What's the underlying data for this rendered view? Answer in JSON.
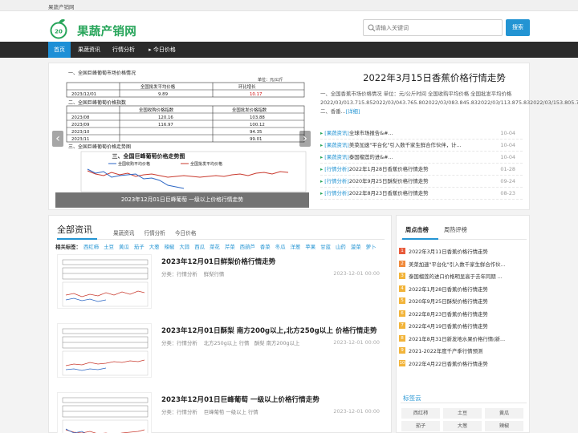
{
  "site": {
    "top_label": "果蔬产销网",
    "logo_text": "果蔬产销网",
    "logo_badge": "20"
  },
  "search": {
    "placeholder": "请输入关键词",
    "button": "搜索"
  },
  "nav": [
    "首页",
    "果蔬资讯",
    "行情分析",
    "▸ 今日价格"
  ],
  "feature": {
    "slide_caption": "2023年12月01日巨峰葡萄 一级以上价格行情走势",
    "chart": {
      "table1_title": "一、全国巨峰葡萄市场价格情况",
      "table1_header": [
        "",
        "全国批发平均价格",
        "环比增长"
      ],
      "table1_rows": [
        [
          "2023/12/01",
          "9.89",
          "10.17"
        ]
      ],
      "table1_note": "单位：元/公斤",
      "table2_title": "二、全国巨峰葡萄价格指数",
      "table2_header": [
        "",
        "全国收购价格指数",
        "全国批发价格指数"
      ],
      "table2_rows": [
        [
          "2023/08",
          "120.16",
          "103.88"
        ],
        [
          "2023/09",
          "116.97",
          "100.12"
        ],
        [
          "2023/10",
          "",
          "94.35"
        ],
        [
          "2023/11",
          "",
          "99.01"
        ]
      ],
      "chart_title": "三、全国巨峰葡萄价格走势图",
      "legend_left": "全国收购平均价格",
      "legend_right": "全国批发平均价格"
    },
    "title": "2022年3月15日香蕉价格行情走势",
    "summary": "一、全国香蕉市场价格情况 单位：元/公斤时间 全国收购平均价格 全国批发平均价格 2022/03/013.715.852022/03/043.765.802022/03/083.845.832022/03/113.875.832022/03/153.805.74二、香番...",
    "more": "[详细]",
    "list": [
      {
        "tag": "[果蔬资讯]",
        "title": "全球市场报告&#...",
        "date": "10-04"
      },
      {
        "tag": "[果蔬资讯]",
        "title": "美菜加速\"平台化\"引入数千家生鲜合作伙伴，计...",
        "date": "10-04"
      },
      {
        "tag": "[果蔬资讯]",
        "title": "泰国榴莲的进&#...",
        "date": "10-04"
      },
      {
        "tag": "[行情分析]",
        "title": "2022年1月28日香蕉价格行情走势",
        "date": "01-28"
      },
      {
        "tag": "[行情分析]",
        "title": "2020年9月25日酥梨价格行情走势",
        "date": "09-24"
      },
      {
        "tag": "[行情分析]",
        "title": "2022年8月23日香蕉价格行情走势",
        "date": "08-23"
      }
    ]
  },
  "main": {
    "title": "全部资讯",
    "tabs": [
      "果蔬资讯",
      "行情分析",
      "今日价格"
    ],
    "tags_label": "相关标签：",
    "tags": [
      "西红柿",
      "土豆",
      "黄瓜",
      "茄子",
      "大葱",
      "辣椒",
      "大蒜",
      "西瓜",
      "菜花",
      "芹菜",
      "西葫芦",
      "香菜",
      "冬瓜",
      "洋葱",
      "苹果",
      "甘蓝",
      "山药",
      "菠菜",
      "萝卜"
    ],
    "posts": [
      {
        "title": "2023年12月01日鲜梨价格行情走势",
        "category": "分类：行情分析",
        "tags": "鲜梨行情",
        "date": "2023-12-01 00:00"
      },
      {
        "title": "2023年12月01日酥梨 南方200g以上,北方250g以上 价格行情走势",
        "category": "分类：行情分析",
        "tags": "北方250g以上 行情　酥梨 南方200g以上",
        "date": "2023-12-01 00:00"
      },
      {
        "title": "2023年12月01日巨峰葡萄 一级以上价格行情走势",
        "category": "分类：行情分析",
        "tags": "巨峰葡萄 一级以上 行情",
        "date": "2023-12-01 00:00"
      }
    ]
  },
  "side": {
    "tabs": [
      "周点击榜",
      "周热评榜"
    ],
    "rank": [
      {
        "n": "1",
        "title": "2022年3月11日香蕉价格行情走势",
        "color": "#e85b3b"
      },
      {
        "n": "2",
        "title": "美菜加速\"平台化\"引入数千家生鲜合作伙...",
        "color": "#f08a3c"
      },
      {
        "n": "3",
        "title": "泰国榴莲的进口价格明显高于去年同期 ...",
        "color": "#f2b43a"
      },
      {
        "n": "4",
        "title": "2022年1月28日香蕉价格行情走势",
        "color": "#f2b43a"
      },
      {
        "n": "5",
        "title": "2020年9月25日酥梨价格行情走势",
        "color": "#f2b43a"
      },
      {
        "n": "6",
        "title": "2022年8月23日香蕉价格行情走势",
        "color": "#f2b43a"
      },
      {
        "n": "7",
        "title": "2022年4月19日香蕉价格行情走势",
        "color": "#f2b43a"
      },
      {
        "n": "8",
        "title": "2021年8月31日新发地水果价格行情(新...",
        "color": "#f2b43a"
      },
      {
        "n": "9",
        "title": "2021-2022年度千产季行情预测",
        "color": "#f2b43a"
      },
      {
        "n": "10",
        "title": "2022年4月22日香蕉价格行情走势",
        "color": "#f2b43a"
      }
    ],
    "tagcloud_title": "标签云",
    "tagcloud": [
      "西红柿",
      "土豆",
      "黄瓜",
      "茄子",
      "大葱",
      "辣椒"
    ]
  },
  "colors": {
    "accent": "#2394d3",
    "brand_green": "#27a55a",
    "nav_dark": "#2b2b2b"
  }
}
